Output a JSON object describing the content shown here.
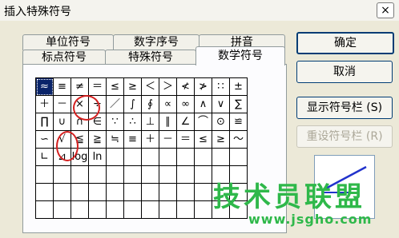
{
  "window": {
    "title": "插入特殊符号",
    "close_glyph": "×"
  },
  "tabs": {
    "back_row": [
      "单位符号",
      "数字序号",
      "拼音"
    ],
    "front_row": [
      "标点符号",
      "特殊符号",
      "数学符号"
    ],
    "active": "数学符号"
  },
  "symbols": [
    [
      "≈",
      "≡",
      "≠",
      "＝",
      "≤",
      "≥",
      "＜",
      "＞",
      "≮",
      "≯",
      "∷",
      "±"
    ],
    [
      "＋",
      "－",
      "×",
      "÷",
      "／",
      "∫",
      "∮",
      "∝",
      "∞",
      "∧",
      "∨",
      "∑"
    ],
    [
      "∏",
      "∪",
      "∩",
      "∈",
      "∵",
      "∴",
      "⊥",
      "∥",
      "∠",
      "⌒",
      "⊙",
      "≌"
    ],
    [
      "∽",
      "√",
      "≦",
      "≧",
      "≒",
      "≡",
      "＋",
      "－",
      "＝",
      "≤",
      "≥",
      "～"
    ],
    [
      "∟",
      "⊿",
      "log",
      "ln",
      "",
      "",
      "",
      "",
      "",
      "",
      "",
      ""
    ],
    [
      "",
      "",
      "",
      "",
      "",
      "",
      "",
      "",
      "",
      "",
      "",
      ""
    ],
    [
      "",
      "",
      "",
      "",
      "",
      "",
      "",
      "",
      "",
      "",
      "",
      ""
    ],
    [
      "",
      "",
      "",
      "",
      "",
      "",
      "",
      "",
      "",
      "",
      "",
      ""
    ]
  ],
  "selected_symbol": "≈",
  "buttons": {
    "ok": "确定",
    "cancel": "取消",
    "show_bar": "显示符号栏 (S)",
    "reset_bar": "重设符号栏 (R)"
  },
  "watermark": {
    "main": "技术员联盟",
    "url": "www.jsgho.com"
  },
  "colors": {
    "selection": "#0a246a",
    "annotation": "#d42020",
    "watermark": "#2fb84a",
    "preview_line": "#2233cc"
  }
}
